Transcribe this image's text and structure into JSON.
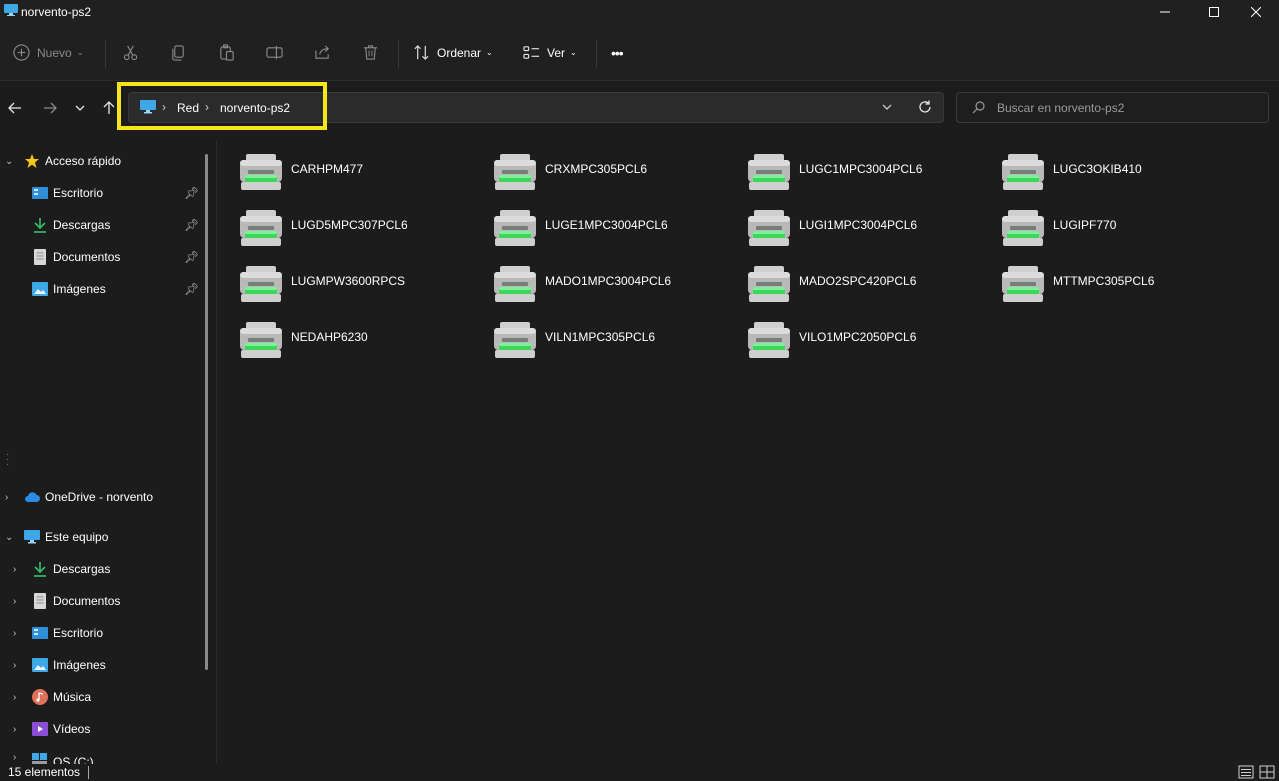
{
  "window": {
    "title": "norvento-ps2"
  },
  "toolbar": {
    "new_label": "Nuevo",
    "sort_label": "Ordenar",
    "view_label": "Ver",
    "more_label": "•••"
  },
  "address": {
    "crumbs": [
      "Red",
      "norvento-ps2"
    ],
    "highlight_color": "#f6e51b"
  },
  "search": {
    "placeholder": "Buscar en norvento-ps2"
  },
  "sidebar": {
    "quick_access": {
      "label": "Acceso rápido",
      "items": [
        {
          "label": "Escritorio",
          "icon": "desktop-icon"
        },
        {
          "label": "Descargas",
          "icon": "download-icon"
        },
        {
          "label": "Documentos",
          "icon": "document-icon"
        },
        {
          "label": "Imágenes",
          "icon": "pictures-icon"
        }
      ]
    },
    "onedrive": {
      "label": "OneDrive - norvento"
    },
    "this_pc": {
      "label": "Este equipo",
      "items": [
        {
          "label": "Descargas",
          "icon": "download-icon"
        },
        {
          "label": "Documentos",
          "icon": "document-icon"
        },
        {
          "label": "Escritorio",
          "icon": "desktop-icon"
        },
        {
          "label": "Imágenes",
          "icon": "pictures-icon"
        },
        {
          "label": "Música",
          "icon": "music-icon"
        },
        {
          "label": "Vídeos",
          "icon": "videos-icon"
        },
        {
          "label": "OS (C:)",
          "icon": "drive-icon"
        }
      ]
    }
  },
  "printers": [
    "CARHPM477",
    "CRXMPC305PCL6",
    "LUGC1MPC3004PCL6",
    "LUGC3OKIB410",
    "LUGD5MPC307PCL6",
    "LUGE1MPC3004PCL6",
    "LUGI1MPC3004PCL6",
    "LUGIPF770",
    "LUGMPW3600RPCS",
    "MADO1MPC3004PCL6",
    "MADO2SPC420PCL6",
    "MTTMPC305PCL6",
    "NEDAHP6230",
    "VILN1MPC305PCL6",
    "VILO1MPC2050PCL6"
  ],
  "status": {
    "count": "15 elementos"
  },
  "colors": {
    "accent": "#4cc2ff",
    "printer_green": "#3cd65a"
  }
}
